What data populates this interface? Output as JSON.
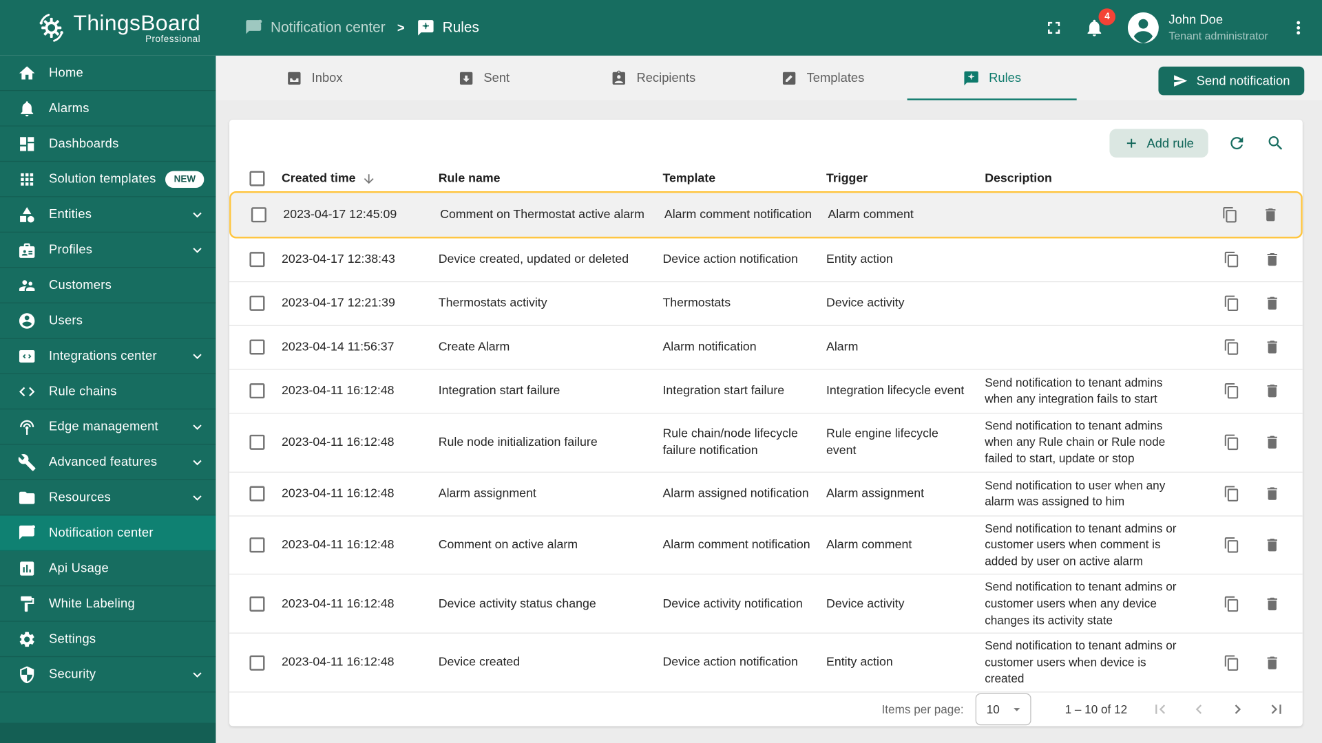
{
  "brand": {
    "name": "ThingsBoard",
    "subtitle": "Professional"
  },
  "breadcrumb": {
    "separator": ">",
    "items": [
      {
        "label": "Notification center",
        "icon": "notification-center-icon"
      },
      {
        "label": "Rules",
        "icon": "rules-icon"
      }
    ]
  },
  "header": {
    "notification_count": "4",
    "user_name": "John Doe",
    "user_role": "Tenant administrator"
  },
  "sidebar": {
    "items": [
      {
        "label": "Home",
        "icon": "home-icon"
      },
      {
        "label": "Alarms",
        "icon": "bell-icon"
      },
      {
        "label": "Dashboards",
        "icon": "dashboards-icon"
      },
      {
        "label": "Solution templates",
        "icon": "solution-templates-icon",
        "badge": "NEW"
      },
      {
        "label": "Entities",
        "icon": "entities-icon",
        "expandable": true
      },
      {
        "label": "Profiles",
        "icon": "profiles-icon",
        "expandable": true
      },
      {
        "label": "Customers",
        "icon": "customers-icon"
      },
      {
        "label": "Users",
        "icon": "users-icon"
      },
      {
        "label": "Integrations center",
        "icon": "integrations-icon",
        "expandable": true
      },
      {
        "label": "Rule chains",
        "icon": "rule-chains-icon"
      },
      {
        "label": "Edge management",
        "icon": "edge-icon",
        "expandable": true
      },
      {
        "label": "Advanced features",
        "icon": "advanced-features-icon",
        "expandable": true
      },
      {
        "label": "Resources",
        "icon": "resources-icon",
        "expandable": true
      },
      {
        "label": "Notification center",
        "icon": "notification-center-icon",
        "active": true
      },
      {
        "label": "Api Usage",
        "icon": "api-usage-icon"
      },
      {
        "label": "White Labeling",
        "icon": "white-labeling-icon"
      },
      {
        "label": "Settings",
        "icon": "settings-icon"
      },
      {
        "label": "Security",
        "icon": "security-icon",
        "expandable": true
      }
    ]
  },
  "tabs": [
    {
      "label": "Inbox",
      "icon": "inbox-icon"
    },
    {
      "label": "Sent",
      "icon": "sent-icon"
    },
    {
      "label": "Recipients",
      "icon": "recipients-icon"
    },
    {
      "label": "Templates",
      "icon": "templates-icon"
    },
    {
      "label": "Rules",
      "icon": "rules-icon",
      "active": true
    }
  ],
  "toolbar": {
    "send_notification_label": "Send notification",
    "add_rule_label": "Add rule"
  },
  "table": {
    "columns": [
      "Created time",
      "Rule name",
      "Template",
      "Trigger",
      "Description"
    ],
    "sort": {
      "column": "Created time",
      "direction": "desc"
    },
    "rows": [
      {
        "created_time": "2023-04-17 12:45:09",
        "rule_name": "Comment on Thermostat active alarm",
        "template": "Alarm comment notification",
        "trigger": "Alarm comment",
        "description": "",
        "highlighted": true
      },
      {
        "created_time": "2023-04-17 12:38:43",
        "rule_name": "Device created, updated or deleted",
        "template": "Device action notification",
        "trigger": "Entity action",
        "description": ""
      },
      {
        "created_time": "2023-04-17 12:21:39",
        "rule_name": "Thermostats activity",
        "template": "Thermostats",
        "trigger": "Device activity",
        "description": ""
      },
      {
        "created_time": "2023-04-14 11:56:37",
        "rule_name": "Create Alarm",
        "template": "Alarm notification",
        "trigger": "Alarm",
        "description": ""
      },
      {
        "created_time": "2023-04-11 16:12:48",
        "rule_name": "Integration start failure",
        "template": "Integration start failure",
        "trigger": "Integration lifecycle event",
        "description": "Send notification to tenant admins when any integration fails to start"
      },
      {
        "created_time": "2023-04-11 16:12:48",
        "rule_name": "Rule node initialization failure",
        "template": "Rule chain/node lifecycle failure notification",
        "trigger": "Rule engine lifecycle event",
        "description": "Send notification to tenant admins when any Rule chain or Rule node failed to start, update or stop"
      },
      {
        "created_time": "2023-04-11 16:12:48",
        "rule_name": "Alarm assignment",
        "template": "Alarm assigned notification",
        "trigger": "Alarm assignment",
        "description": "Send notification to user when any alarm was assigned to him"
      },
      {
        "created_time": "2023-04-11 16:12:48",
        "rule_name": "Comment on active alarm",
        "template": "Alarm comment notification",
        "trigger": "Alarm comment",
        "description": "Send notification to tenant admins or customer users when comment is added by user on active alarm"
      },
      {
        "created_time": "2023-04-11 16:12:48",
        "rule_name": "Device activity status change",
        "template": "Device activity notification",
        "trigger": "Device activity",
        "description": "Send notification to tenant admins or customer users when any device changes its activity state"
      },
      {
        "created_time": "2023-04-11 16:12:48",
        "rule_name": "Device created",
        "template": "Device action notification",
        "trigger": "Entity action",
        "description": "Send notification to tenant admins or customer users when device is created"
      }
    ]
  },
  "pagination": {
    "items_per_page_label": "Items per page:",
    "items_per_page_value": "10",
    "range_label": "1 – 10 of 12"
  },
  "colors": {
    "primary": "#176D60",
    "sidebar_active": "#0F8172",
    "accent": "#0E7A6C",
    "badge_red": "#F44336",
    "highlight_border": "#FFC53D"
  }
}
